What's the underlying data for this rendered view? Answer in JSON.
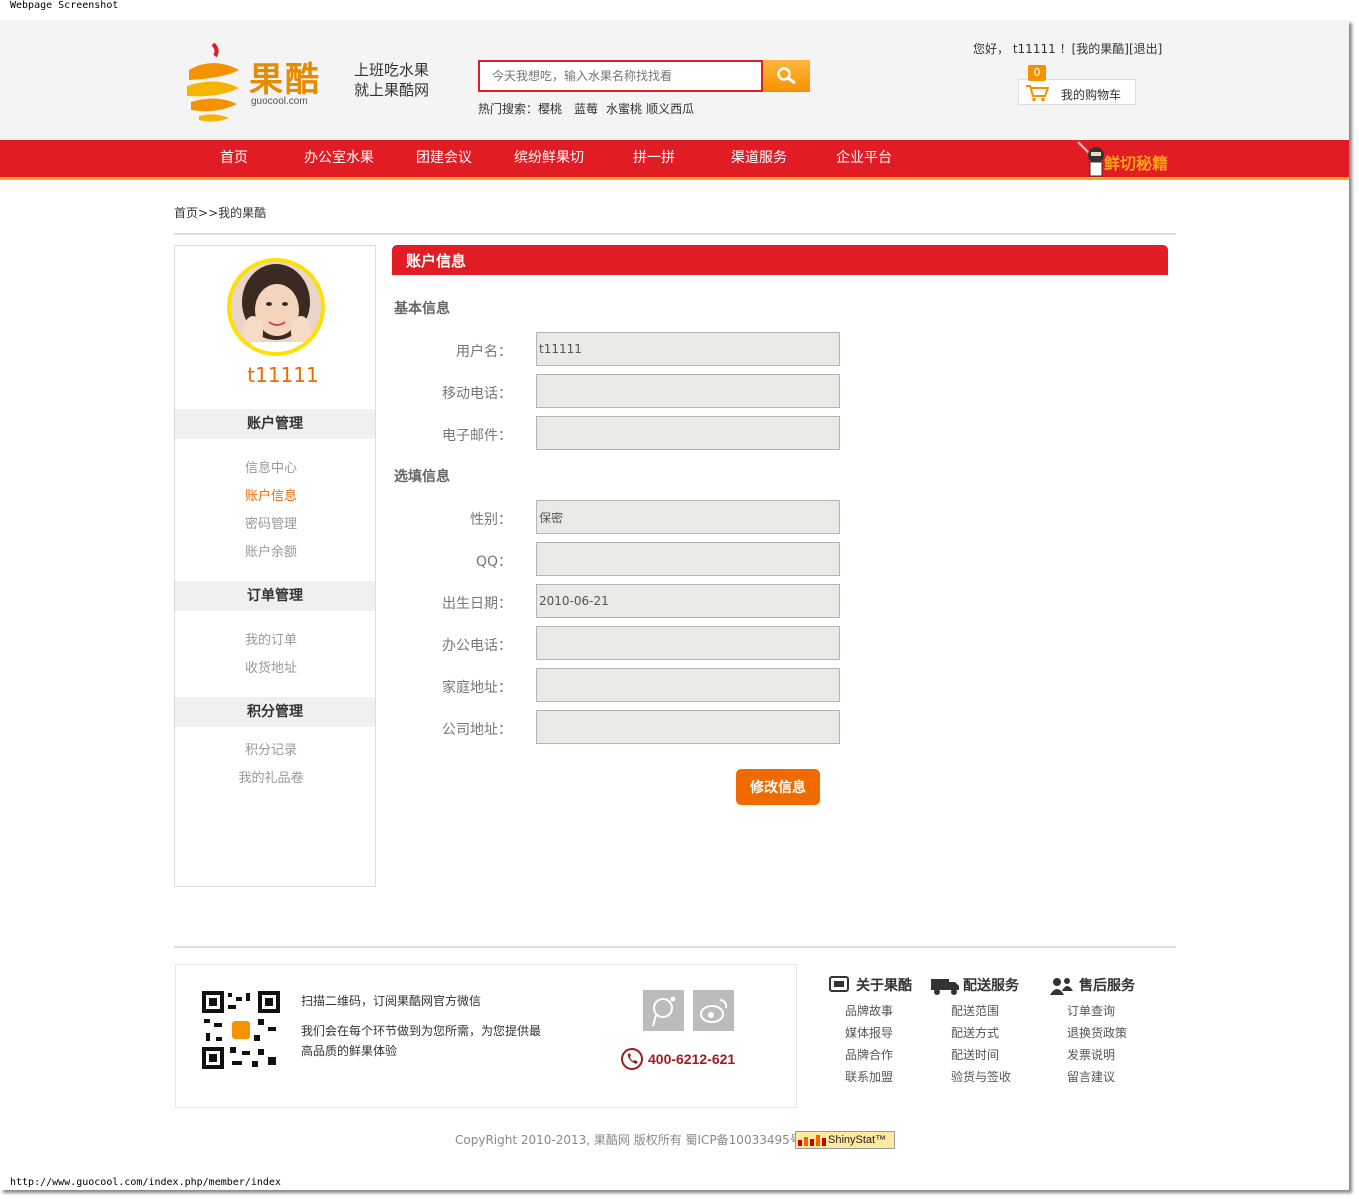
{
  "frame": {
    "top_label": "Webpage Screenshot",
    "url": "http://www.guocool.com/index.php/member/index"
  },
  "header": {
    "logo_text": "果酷",
    "logo_domain": "guocool.com",
    "slogan_line1": "上班吃水果",
    "slogan_line2": "就上果酷网",
    "search_placeholder": "今天我想吃，输入水果名称找找看",
    "hot_label": "热门搜索：",
    "hot_items": [
      "樱桃",
      "蓝莓",
      "水蜜桃",
      "顺义西瓜"
    ],
    "greeting": "您好，",
    "user": "t11111",
    "greeting_sep": "！",
    "my_account_link": "[我的果酷]",
    "logout_link": "[退出]",
    "cart_count": "0",
    "cart_label": "我的购物车"
  },
  "nav": {
    "items": [
      "首页",
      "办公室水果",
      "团建会议",
      "缤纷鲜果切",
      "拼一拼",
      "渠道服务",
      "企业平台"
    ],
    "promo_text": "鲜切秘籍"
  },
  "breadcrumb": {
    "home": "首页",
    "sep": ">>",
    "current": "我的果酷"
  },
  "sidebar": {
    "username": "t11111",
    "groups": [
      {
        "title": "账户管理",
        "links": [
          "信息中心",
          "账户信息",
          "密码管理",
          "账户余额"
        ]
      },
      {
        "title": "订单管理",
        "links": [
          "我的订单",
          "收货地址"
        ]
      },
      {
        "title": "积分管理",
        "links": [
          "积分记录",
          "我的礼品卷"
        ]
      }
    ],
    "active_link": "账户信息"
  },
  "main": {
    "title": "账户信息",
    "basic_section": "基本信息",
    "optional_section": "选填信息",
    "fields": {
      "username": {
        "label": "用户名：",
        "value": "t11111"
      },
      "mobile": {
        "label": "移动电话：",
        "value": ""
      },
      "email": {
        "label": "电子邮件：",
        "value": ""
      },
      "gender": {
        "label": "性别：",
        "value": "保密"
      },
      "qq": {
        "label": "QQ：",
        "value": ""
      },
      "birthday": {
        "label": "出生日期：",
        "value": "2010-06-21"
      },
      "office_phone": {
        "label": "办公电话：",
        "value": ""
      },
      "home_address": {
        "label": "家庭地址：",
        "value": ""
      },
      "company_address": {
        "label": "公司地址：",
        "value": ""
      }
    },
    "submit_label": "修改信息"
  },
  "footer": {
    "wechat_title": "扫描二维码，订阅果酷网官方微信",
    "wechat_desc": "我们会在每个环节做到为您所需，为您提供最高品质的鲜果体验",
    "phone": "400-6212-621",
    "columns": [
      {
        "title": "关于果酷",
        "links": [
          "品牌故事",
          "媒体报导",
          "品牌合作",
          "联系加盟"
        ]
      },
      {
        "title": "配送服务",
        "links": [
          "配送范围",
          "配送方式",
          "配送时间",
          "验货与签收"
        ]
      },
      {
        "title": "售后服务",
        "links": [
          "订单查询",
          "退换货政策",
          "发票说明",
          "留言建议"
        ]
      }
    ],
    "copyright": "CopyRight 2010-2013, 果酷网 版权所有 蜀ICP备10033495号",
    "stat_badge": "ShinyStat™"
  },
  "colors": {
    "brand_red": "#e11c24",
    "brand_orange": "#f06a00",
    "accent_yellow": "#f7a21b"
  }
}
